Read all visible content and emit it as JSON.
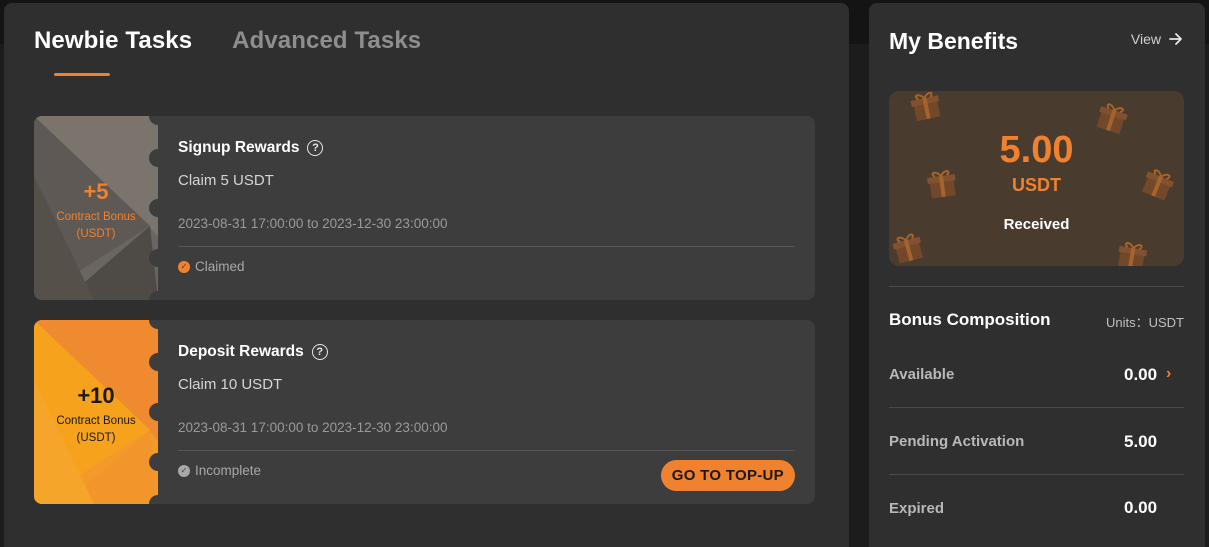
{
  "tabs": [
    {
      "label": "Newbie Tasks",
      "active": true
    },
    {
      "label": "Advanced Tasks",
      "active": false
    }
  ],
  "tasks": [
    {
      "ticket_amount": "+5",
      "ticket_line1": "Contract Bonus",
      "ticket_line2": "(USDT)",
      "title": "Signup Rewards",
      "claim": "Claim 5 USDT",
      "period": "2023-08-31 17:00:00 to 2023-12-30 23:00:00",
      "status": "Claimed",
      "status_icon": "check-circle-icon"
    },
    {
      "ticket_amount": "+10",
      "ticket_line1": "Contract Bonus",
      "ticket_line2": "(USDT)",
      "title": "Deposit Rewards",
      "claim": "Claim 10 USDT",
      "period": "2023-08-31 17:00:00 to 2023-12-30 23:00:00",
      "status": "Incomplete",
      "status_icon": "check-circle-icon",
      "action_label": "GO TO TOP-UP"
    }
  ],
  "benefits": {
    "title": "My Benefits",
    "view_label": "View",
    "amount": "5.00",
    "unit": "USDT",
    "received_label": "Received",
    "composition_title": "Bonus Composition",
    "units_label": "Units：USDT",
    "rows": [
      {
        "label": "Available",
        "value": "0.00",
        "has_chevron": true
      },
      {
        "label": "Pending Activation",
        "value": "5.00",
        "has_chevron": false
      },
      {
        "label": "Expired",
        "value": "0.00",
        "has_chevron": false
      }
    ]
  },
  "colors": {
    "accent": "#f0812e",
    "panel": "#2f2f2f",
    "card": "#3d3d3d",
    "benefit_card": "#4a3b2f"
  }
}
